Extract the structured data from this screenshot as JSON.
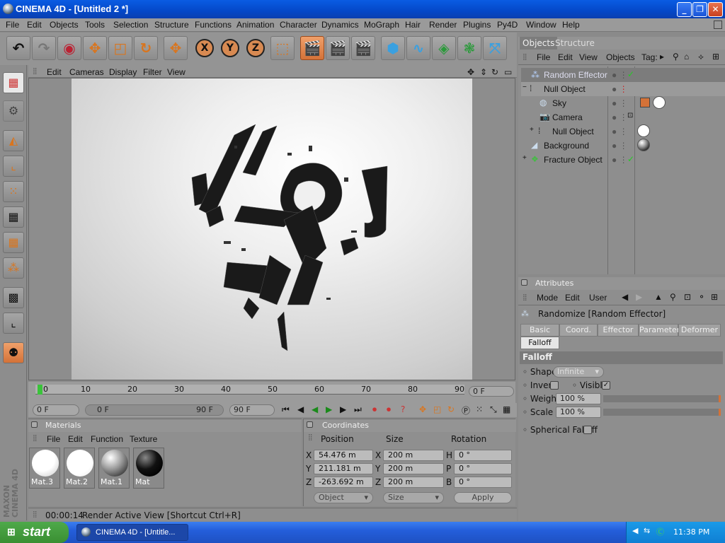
{
  "window": {
    "title": "CINEMA 4D - [Untitled 2 *]",
    "min": "_",
    "max": "❐",
    "close": "✕"
  },
  "menu": [
    "File",
    "Edit",
    "Objects",
    "Tools",
    "Selection",
    "Structure",
    "Functions",
    "Animation",
    "Character",
    "Dynamics",
    "MoGraph",
    "Hair",
    "Render",
    "Plugins",
    "Py4D",
    "Window",
    "Help"
  ],
  "toolbar_icons": [
    "undo-icon",
    "redo-icon",
    "live-select-icon",
    "move-icon",
    "scale-icon",
    "rotate-icon",
    "move-tool-icon",
    "x-axis-icon",
    "y-axis-icon",
    "z-axis-icon",
    "world-coords-icon",
    "render-view-icon",
    "render-picture-viewer-icon",
    "render-settings-icon",
    "cube-icon",
    "spline-icon",
    "nurbs-icon",
    "array-icon",
    "deformer-icon"
  ],
  "xyz": {
    "x": "X",
    "y": "Y",
    "z": "Z"
  },
  "viewport_menu": {
    "edit": "Edit",
    "cameras": "Cameras",
    "display": "Display",
    "filter": "Filter",
    "view": "View"
  },
  "timeline": {
    "ticks": [
      "0",
      "10",
      "20",
      "30",
      "40",
      "50",
      "60",
      "70",
      "80",
      "90"
    ],
    "current_frame": "0 F",
    "start_field": "0 F",
    "range_start": "0 F",
    "range_end": "90 F",
    "end_field": "90 F"
  },
  "objects_panel": {
    "tab_objects": "Objects",
    "tab_structure": "Structure",
    "menu": {
      "file": "File",
      "edit": "Edit",
      "view": "View",
      "objects": "Objects",
      "tags": "Tag:"
    },
    "rows": [
      {
        "name": "Random Effector",
        "icon": "effector-icon",
        "indent": 0,
        "expander": "",
        "status": "✓"
      },
      {
        "name": "Null Object",
        "icon": "null-icon",
        "indent": 0,
        "expander": "−",
        "status": ""
      },
      {
        "name": "Sky",
        "icon": "sky-icon",
        "indent": 1,
        "expander": "",
        "status": ""
      },
      {
        "name": "Camera",
        "icon": "camera-icon",
        "indent": 1,
        "expander": "",
        "status": ""
      },
      {
        "name": "Null Object",
        "icon": "null-icon",
        "indent": 1,
        "expander": "+",
        "status": ""
      },
      {
        "name": "Background",
        "icon": "background-icon",
        "indent": 0,
        "expander": "",
        "status": ""
      },
      {
        "name": "Fracture Object",
        "icon": "fracture-icon",
        "indent": 0,
        "expander": "+",
        "status": "✓"
      }
    ]
  },
  "attributes": {
    "header": "Attributes",
    "menu": {
      "mode": "Mode",
      "edit": "Edit",
      "user": "User"
    },
    "object_title": "Randomize [Random Effector]",
    "tabs": [
      "Basic",
      "Coord.",
      "Effector",
      "Parameter",
      "Deformer"
    ],
    "active_tab": "Falloff",
    "section": "Falloff",
    "shape_label": "Shape",
    "shape_value": "Infinite",
    "invert_label": "Invert",
    "visible_label": "Visible",
    "weight_label": "Weight",
    "weight_value": "100 %",
    "scale_label": "Scale",
    "scale_value": "100 %",
    "spherical_label": "Spherical Falloff"
  },
  "materials": {
    "header": "Materials",
    "menu": {
      "file": "File",
      "edit": "Edit",
      "function": "Function",
      "texture": "Texture"
    },
    "items": [
      "Mat.3",
      "Mat.2",
      "Mat.1",
      "Mat"
    ]
  },
  "coordinates": {
    "header": "Coordinates",
    "col_position": "Position",
    "col_size": "Size",
    "col_rotation": "Rotation",
    "rows": [
      {
        "axis": "X",
        "pos": "54.476 m",
        "size_axis": "X",
        "size": "200 m",
        "rot_axis": "H",
        "rot": "0 °"
      },
      {
        "axis": "Y",
        "pos": "211.181 m",
        "size_axis": "Y",
        "size": "200 m",
        "rot_axis": "P",
        "rot": "0 °"
      },
      {
        "axis": "Z",
        "pos": "-263.692 m",
        "size_axis": "Z",
        "size": "200 m",
        "rot_axis": "B",
        "rot": "0 °"
      }
    ],
    "mode_object": "Object",
    "mode_size": "Size",
    "apply": "Apply"
  },
  "status": {
    "time": "00:00:14",
    "message": "Render Active View [Shortcut Ctrl+R]"
  },
  "maxon": {
    "line1": "MAXON",
    "line2": "CINEMA 4D"
  },
  "taskbar": {
    "start": "start",
    "task": "CINEMA 4D - [Untitle...",
    "lang": "EN",
    "clock": "11:38 PM"
  }
}
